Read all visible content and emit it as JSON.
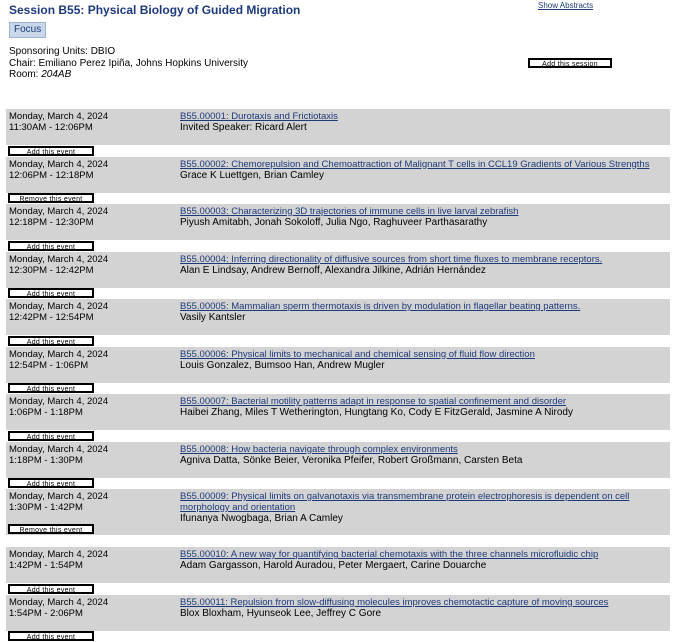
{
  "session": {
    "title": "Session B55: Physical Biology of Guided Migration",
    "focus_label": "Focus",
    "show_abstracts": "Show Abstracts",
    "sponsoring": "Sponsoring Units: DBIO",
    "chair": "Chair: Emiliano Perez Ipiña, Johns Hopkins University",
    "room_label": "Room: ",
    "room_value": "204AB",
    "add_session": "Add this session"
  },
  "events": [
    {
      "date": "Monday, March 4, 2024",
      "time": "11:30AM - 12:06PM",
      "title": "B55.00001: Durotaxis and Frictiotaxis",
      "speakers": "Invited Speaker: Ricard Alert",
      "button": "Add this event"
    },
    {
      "date": "Monday, March 4, 2024",
      "time": "12:06PM - 12:18PM",
      "title": "B55.00002: Chemorepulsion and Chemoattraction of Malignant T cells in CCL19 Gradients of Various Strengths",
      "speakers": "Grace K Luettgen, Brian Camley",
      "button": "Remove this event"
    },
    {
      "date": "Monday, March 4, 2024",
      "time": "12:18PM - 12:30PM",
      "title": "B55.00003: Characterizing 3D trajectories of immune cells in live larval zebrafish",
      "speakers": "Piyush Amitabh, Jonah Sokoloff, Julia Ngo, Raghuveer Parthasarathy",
      "button": "Add this event"
    },
    {
      "date": "Monday, March 4, 2024",
      "time": "12:30PM - 12:42PM",
      "title": "B55.00004: Inferring directionality of diffusive sources from short time fluxes to membrane receptors.",
      "speakers": "Alan E Lindsay, Andrew Bernoff, Alexandra Jilkine, Adrián Hernández",
      "button": "Add this event"
    },
    {
      "date": "Monday, March 4, 2024",
      "time": "12:42PM - 12:54PM",
      "title": "B55.00005: Mammalian sperm thermotaxis is driven by modulation in flagellar beating patterns.",
      "speakers": "Vasily Kantsler",
      "button": "Add this event"
    },
    {
      "date": "Monday, March 4, 2024",
      "time": "12:54PM - 1:06PM",
      "title": "B55.00006: Physical limits to mechanical and chemical sensing of fluid flow direction",
      "speakers": "Louis Gonzalez, Bumsoo Han, Andrew Mugler",
      "button": "Add this event"
    },
    {
      "date": "Monday, March 4, 2024",
      "time": "1:06PM - 1:18PM",
      "title": "B55.00007: Bacterial motility patterns adapt in response to spatial confinement and disorder",
      "speakers": "Haibei Zhang, Miles T Wetherington, Hungtang Ko, Cody E FitzGerald, Jasmine A Nirody",
      "button": "Add this event"
    },
    {
      "date": "Monday, March 4, 2024",
      "time": "1:18PM - 1:30PM",
      "title": "B55.00008: How bacteria navigate through complex environments",
      "speakers": "Agniva Datta, Sönke Beier, Veronika Pfeifer, Robert Großmann, Carsten Beta",
      "button": "Add this event"
    },
    {
      "date": "Monday, March 4, 2024",
      "time": "1:30PM - 1:42PM",
      "title": "B55.00009: Physical limits on galvanotaxis via transmembrane protein electrophoresis is dependent on cell morphology and orientation",
      "speakers": "Ifunanya Nwogbaga, Brian A Camley",
      "button": "Remove this event",
      "tall": true
    },
    {
      "date": "Monday, March 4, 2024",
      "time": "1:42PM - 1:54PM",
      "title": "B55.00010: A new way for quantifying bacterial chemotaxis with the three channels microfluidic chip",
      "speakers": "Adam Gargasson, Harold Auradou, Peter Mergaert, Carine Douarche",
      "button": "Add this event"
    },
    {
      "date": "Monday, March 4, 2024",
      "time": "1:54PM - 2:06PM",
      "title": "B55.00011: Repulsion from slow-diffusing molecules improves chemotactic capture of moving sources",
      "speakers": "Blox Bloxham, Hyunseok Lee, Jeffrey C Gore",
      "button": "Add this event"
    }
  ]
}
